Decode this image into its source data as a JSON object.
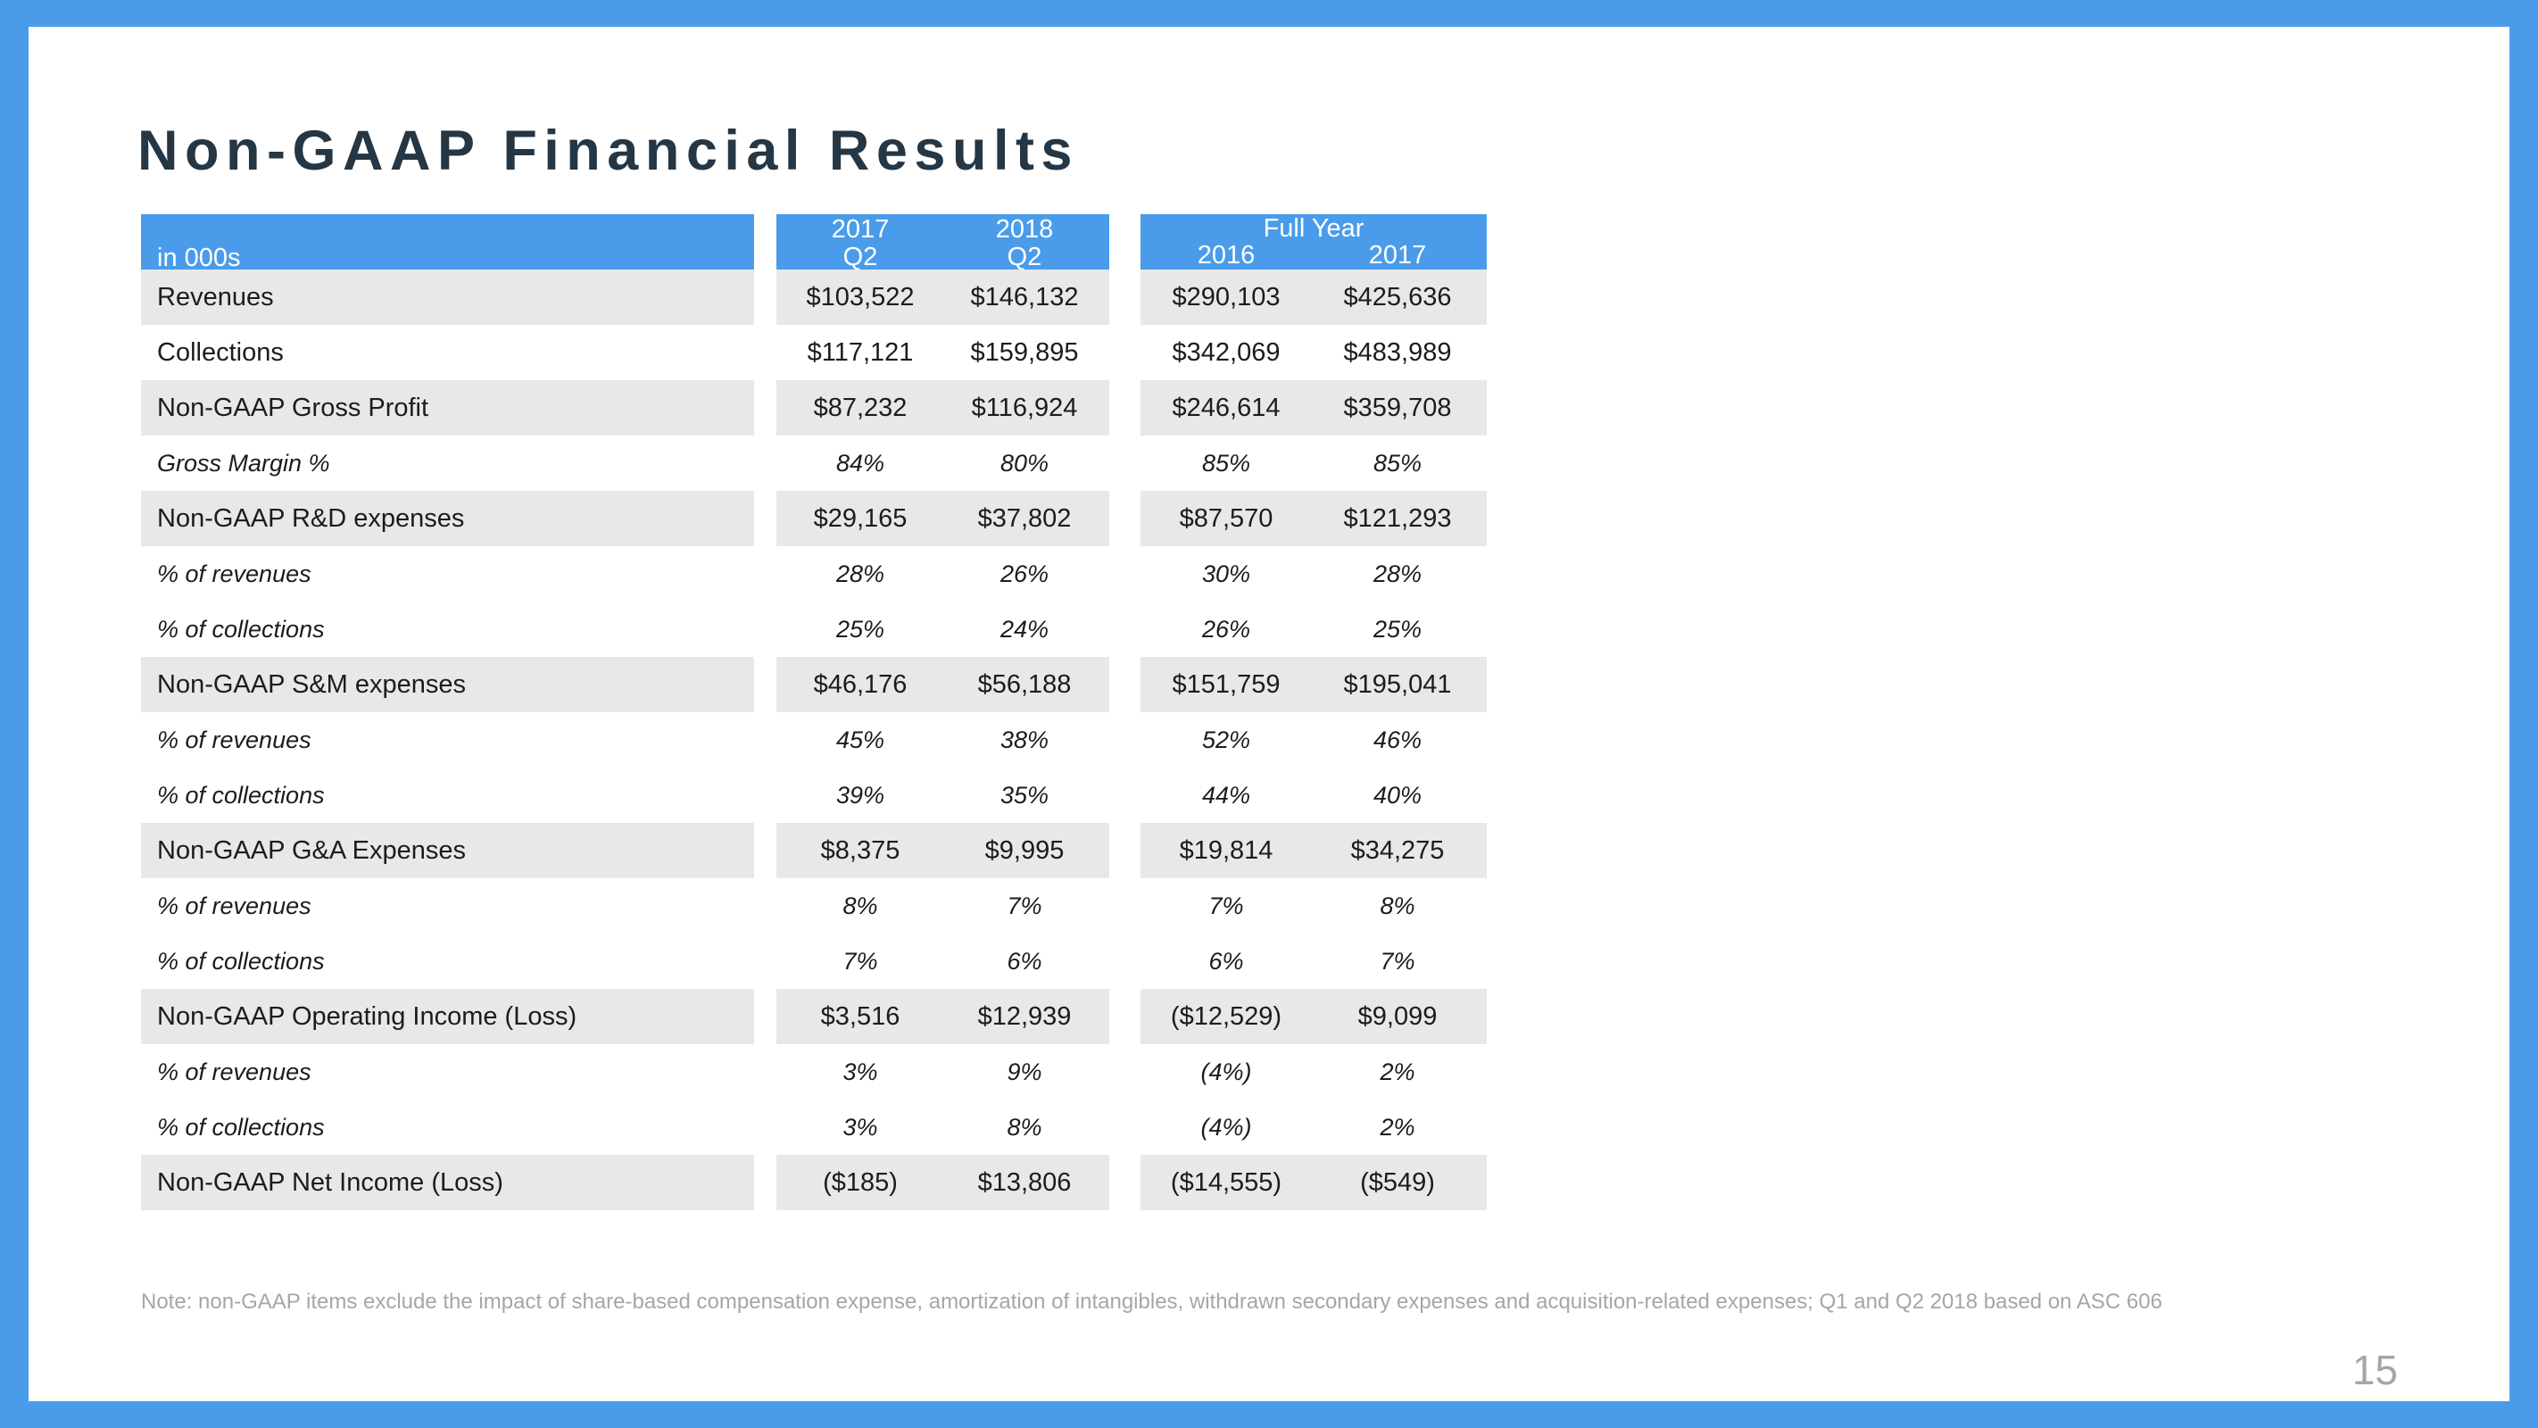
{
  "slide": {
    "title": "Non-GAAP Financial Results",
    "page_number": "15",
    "accent_color": "#4a9ceb",
    "title_color": "#253645",
    "band_color": "#e8e8e8",
    "footnote_color": "#a6a6a6"
  },
  "table": {
    "label_header": "in 000s",
    "quarter_group": {
      "col1": {
        "year": "2017",
        "period": "Q2"
      },
      "col2": {
        "year": "2018",
        "period": "Q2"
      }
    },
    "fullyear_group": {
      "title": "Full Year",
      "col1": "2016",
      "col2": "2017"
    },
    "rows": [
      {
        "label": "Revenues",
        "type": "main",
        "shade": true,
        "q1": "$103,522",
        "q2": "$146,132",
        "y1": "$290,103",
        "y2": "$425,636"
      },
      {
        "label": "Collections",
        "type": "main",
        "shade": false,
        "q1": "$117,121",
        "q2": "$159,895",
        "y1": "$342,069",
        "y2": "$483,989"
      },
      {
        "label": "Non-GAAP Gross Profit",
        "type": "main",
        "shade": true,
        "q1": "$87,232",
        "q2": "$116,924",
        "y1": "$246,614",
        "y2": "$359,708"
      },
      {
        "label": "Gross Margin %",
        "type": "sub",
        "shade": false,
        "q1": "84%",
        "q2": "80%",
        "y1": "85%",
        "y2": "85%"
      },
      {
        "label": "Non-GAAP R&D expenses",
        "type": "main",
        "shade": true,
        "q1": "$29,165",
        "q2": "$37,802",
        "y1": "$87,570",
        "y2": "$121,293"
      },
      {
        "label": "% of revenues",
        "type": "sub",
        "shade": false,
        "q1": "28%",
        "q2": "26%",
        "y1": "30%",
        "y2": "28%"
      },
      {
        "label": "% of collections",
        "type": "sub",
        "shade": false,
        "q1": "25%",
        "q2": "24%",
        "y1": "26%",
        "y2": "25%"
      },
      {
        "label": "Non-GAAP S&M expenses",
        "type": "main",
        "shade": true,
        "q1": "$46,176",
        "q2": "$56,188",
        "y1": "$151,759",
        "y2": "$195,041"
      },
      {
        "label": "% of revenues",
        "type": "sub",
        "shade": false,
        "q1": "45%",
        "q2": "38%",
        "y1": "52%",
        "y2": "46%"
      },
      {
        "label": "% of collections",
        "type": "sub",
        "shade": false,
        "q1": "39%",
        "q2": "35%",
        "y1": "44%",
        "y2": "40%"
      },
      {
        "label": "Non-GAAP G&A Expenses",
        "type": "main",
        "shade": true,
        "q1": "$8,375",
        "q2": "$9,995",
        "y1": "$19,814",
        "y2": "$34,275"
      },
      {
        "label": "% of revenues",
        "type": "sub",
        "shade": false,
        "q1": "8%",
        "q2": "7%",
        "y1": "7%",
        "y2": "8%"
      },
      {
        "label": "% of collections",
        "type": "sub",
        "shade": false,
        "q1": "7%",
        "q2": "6%",
        "y1": "6%",
        "y2": "7%"
      },
      {
        "label": "Non-GAAP Operating Income (Loss)",
        "type": "main",
        "shade": true,
        "q1": "$3,516",
        "q2": "$12,939",
        "y1": "($12,529)",
        "y2": "$9,099"
      },
      {
        "label": "% of revenues",
        "type": "sub",
        "shade": false,
        "q1": "3%",
        "q2": "9%",
        "y1": "(4%)",
        "y2": "2%"
      },
      {
        "label": "% of collections",
        "type": "sub",
        "shade": false,
        "q1": "3%",
        "q2": "8%",
        "y1": "(4%)",
        "y2": "2%"
      },
      {
        "label": "Non-GAAP Net Income (Loss)",
        "type": "main",
        "shade": true,
        "q1": "($185)",
        "q2": "$13,806",
        "y1": "($14,555)",
        "y2": "($549)"
      }
    ]
  },
  "footnote": {
    "text": "Note: non-GAAP items exclude the impact of share-based compensation expense, amortization of intangibles, withdrawn secondary expenses and acquisition-related expenses; Q1 and Q2 2018 based on ASC 606"
  }
}
